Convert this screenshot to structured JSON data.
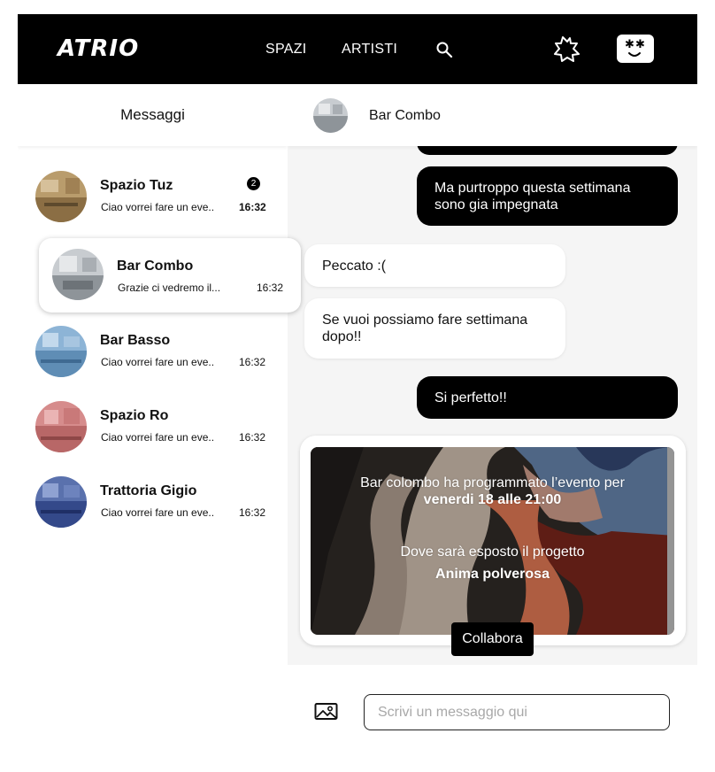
{
  "header": {
    "logo": "ATRIO",
    "nav": [
      "SPAZI",
      "ARTISTI"
    ],
    "icons": [
      "search-icon",
      "star-profile-icon",
      "avatar-face-icon"
    ]
  },
  "sidebar": {
    "title": "Messaggi",
    "conversations": [
      {
        "name": "Spazio Tuz",
        "preview": "Ciao vorrei fare un eve..",
        "time": "16:32",
        "unread": "2"
      },
      {
        "name": "Bar Combo",
        "preview": "Grazie ci vedremo il...",
        "time": "16:32"
      },
      {
        "name": "Bar Basso",
        "preview": "Ciao vorrei fare un eve..",
        "time": "16:32"
      },
      {
        "name": "Spazio Ro",
        "preview": "Ciao vorrei fare un eve..",
        "time": "16:32"
      },
      {
        "name": "Trattoria Gigio",
        "preview": "Ciao vorrei fare un eve..",
        "time": "16:32"
      }
    ]
  },
  "chat": {
    "contact": "Bar Combo",
    "messages": [
      {
        "from": "me",
        "text": "Ma purtroppo questa settimana sono gia impegnata"
      },
      {
        "from": "them",
        "text": "Peccato :("
      },
      {
        "from": "them",
        "text": "Se vuoi possiamo fare settimana dopo!!"
      },
      {
        "from": "me",
        "text": "Si perfetto!!"
      }
    ],
    "event": {
      "line1": "Bar colombo ha programmato l’evento per",
      "line2": "venerdi 18 alle 21:00",
      "line3": "Dove sarà esposto il progetto",
      "line4": "Anima polverosa",
      "button": "Collabora"
    },
    "composer": {
      "placeholder": "Scrivi un messaggio qui"
    }
  },
  "colors": {
    "primary": "#000000",
    "background": "#f5f5f5",
    "surface": "#ffffff"
  }
}
